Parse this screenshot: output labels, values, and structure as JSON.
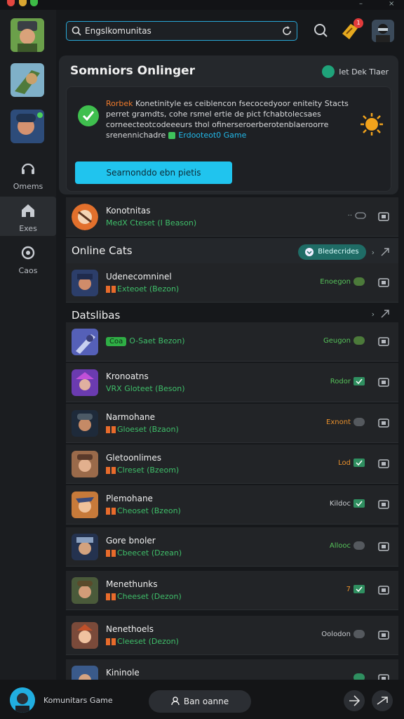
{
  "window": {
    "minimize": "–",
    "close": "×"
  },
  "sidebar": {
    "nav": [
      {
        "label": "Omems",
        "icon": "headset-icon"
      },
      {
        "label": "Exes",
        "icon": "home-icon"
      },
      {
        "label": "Caos",
        "icon": "settings-icon"
      }
    ]
  },
  "header": {
    "search_value": "Engslkomunitas",
    "notification_count": "1"
  },
  "card": {
    "title": "Somniors Onlinger",
    "toggle_label": "Iet Dek Tlaer",
    "text_line1_hl": "Rorbek",
    "text_line1": " Konetinityle es ceiblencon  fsecocedyoor eniteity  Stacts",
    "text_line2": "perret gramdts, cohe rsmel ertie de pict fchabtolecsaes",
    "text_line3": "corneecteotcodeeeurs thol ofinerseroerberotenblaeroorre",
    "text_line4": "srenennichadre",
    "text_line4_link": "Erdooteot0 Game",
    "button_label": "Searnonddo ebn pietis"
  },
  "list": {
    "top_row": {
      "name": "Konotnitas",
      "sub": "MedX Cteset (I Beason)"
    },
    "section1": {
      "title": "Online Cats",
      "pill_label": "Bledecrides"
    },
    "row1": {
      "name": "Udenecomninel",
      "sub": "Exteoet (Bezon)",
      "status": "Enoegon"
    },
    "section2": {
      "title": "Datslibas"
    },
    "rows": [
      {
        "tag": "Coa",
        "name": "",
        "sub": "O-Saet Bezon)",
        "status": "Geugon"
      },
      {
        "name": "Kronoatns",
        "sub": "VRX Gloteet (Beson)",
        "status": "Rodor"
      },
      {
        "name": "Narmohane",
        "sub": "Gloeset (Bzaon)",
        "status": "Exnont"
      },
      {
        "name": "Gletoonlimes",
        "sub": "Clreset (Bzeom)",
        "status": "Lod"
      },
      {
        "name": "Plemohane",
        "sub": "Cheoset (Bzeon)",
        "status": "Kildoc"
      },
      {
        "name": "Gore bnoler",
        "sub": "Cbeecet (Dzean)",
        "status": "Allooc"
      },
      {
        "name": "Menethunks",
        "sub": "Cheeset (Dezon)",
        "status": "7"
      },
      {
        "name": "Nenethoels",
        "sub": "Cleeset (Dezon)",
        "status": "Oolodon"
      },
      {
        "name": "Kininole",
        "sub": "",
        "status": ""
      }
    ]
  },
  "footer": {
    "name": "Komunitars Game",
    "button_label": "Ban oanne"
  }
}
